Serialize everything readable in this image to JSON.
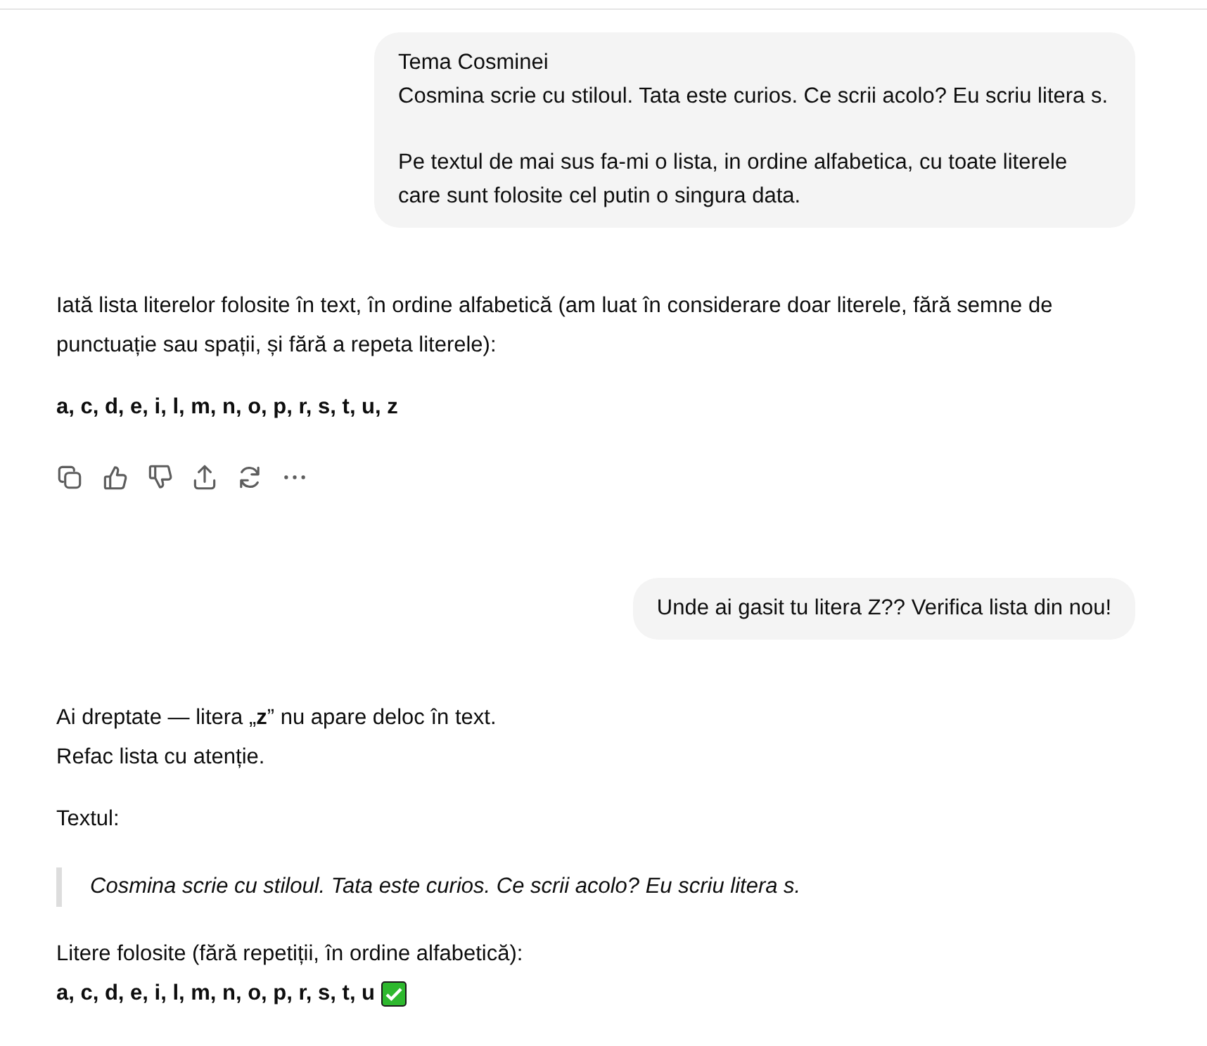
{
  "messages": [
    {
      "kind": "user",
      "paragraphs": [
        [
          "Tema Cosminei",
          "Cosmina scrie cu stiloul. Tata este curios. Ce scrii acolo? Eu scriu litera s."
        ],
        [
          "Pe textul de mai sus fa-mi o lista, in ordine alfabetica, cu toate literele care sunt folosite cel putin o singura data."
        ]
      ]
    },
    {
      "kind": "assistant",
      "show_actions": true,
      "blocks": [
        {
          "kind": "paragraph",
          "lines": [
            {
              "text": "Iată lista literelor folosite în text, în ordine alfabetică (am luat în considerare doar literele, fără semne de punctuație sau spații, și fără a repeta literele):",
              "bold": false,
              "check_mark": false
            }
          ]
        },
        {
          "kind": "paragraph",
          "lines": [
            {
              "text": "a, c, d, e, i, l, m, n, o, p, r, s, t, u, z",
              "bold": true,
              "check_mark": false
            }
          ]
        }
      ]
    },
    {
      "kind": "user",
      "paragraphs": [
        [
          "Unde ai gasit tu litera Z?? Verifica lista din nou!"
        ]
      ]
    },
    {
      "kind": "assistant",
      "show_actions": false,
      "blocks": [
        {
          "kind": "paragraph",
          "lines": [
            {
              "text": "Ai dreptate — litera „**z**” nu apare deloc în text.",
              "bold": false,
              "check_mark": false
            },
            {
              "text": "Refac lista cu atenție.",
              "bold": false,
              "check_mark": false
            }
          ]
        },
        {
          "kind": "paragraph",
          "lines": [
            {
              "text": "Textul:",
              "bold": false,
              "check_mark": false
            }
          ]
        },
        {
          "kind": "quote",
          "text": "Cosmina scrie cu stiloul. Tata este curios. Ce scrii acolo? Eu scriu litera s."
        },
        {
          "kind": "paragraph",
          "lines": [
            {
              "text": "Litere folosite (fără repetiții, în ordine alfabetică):",
              "bold": false,
              "check_mark": false
            },
            {
              "text": "a, c, d, e, i, l, m, n, o, p, r, s, t, u",
              "bold": true,
              "check_mark": true
            }
          ]
        }
      ]
    }
  ]
}
